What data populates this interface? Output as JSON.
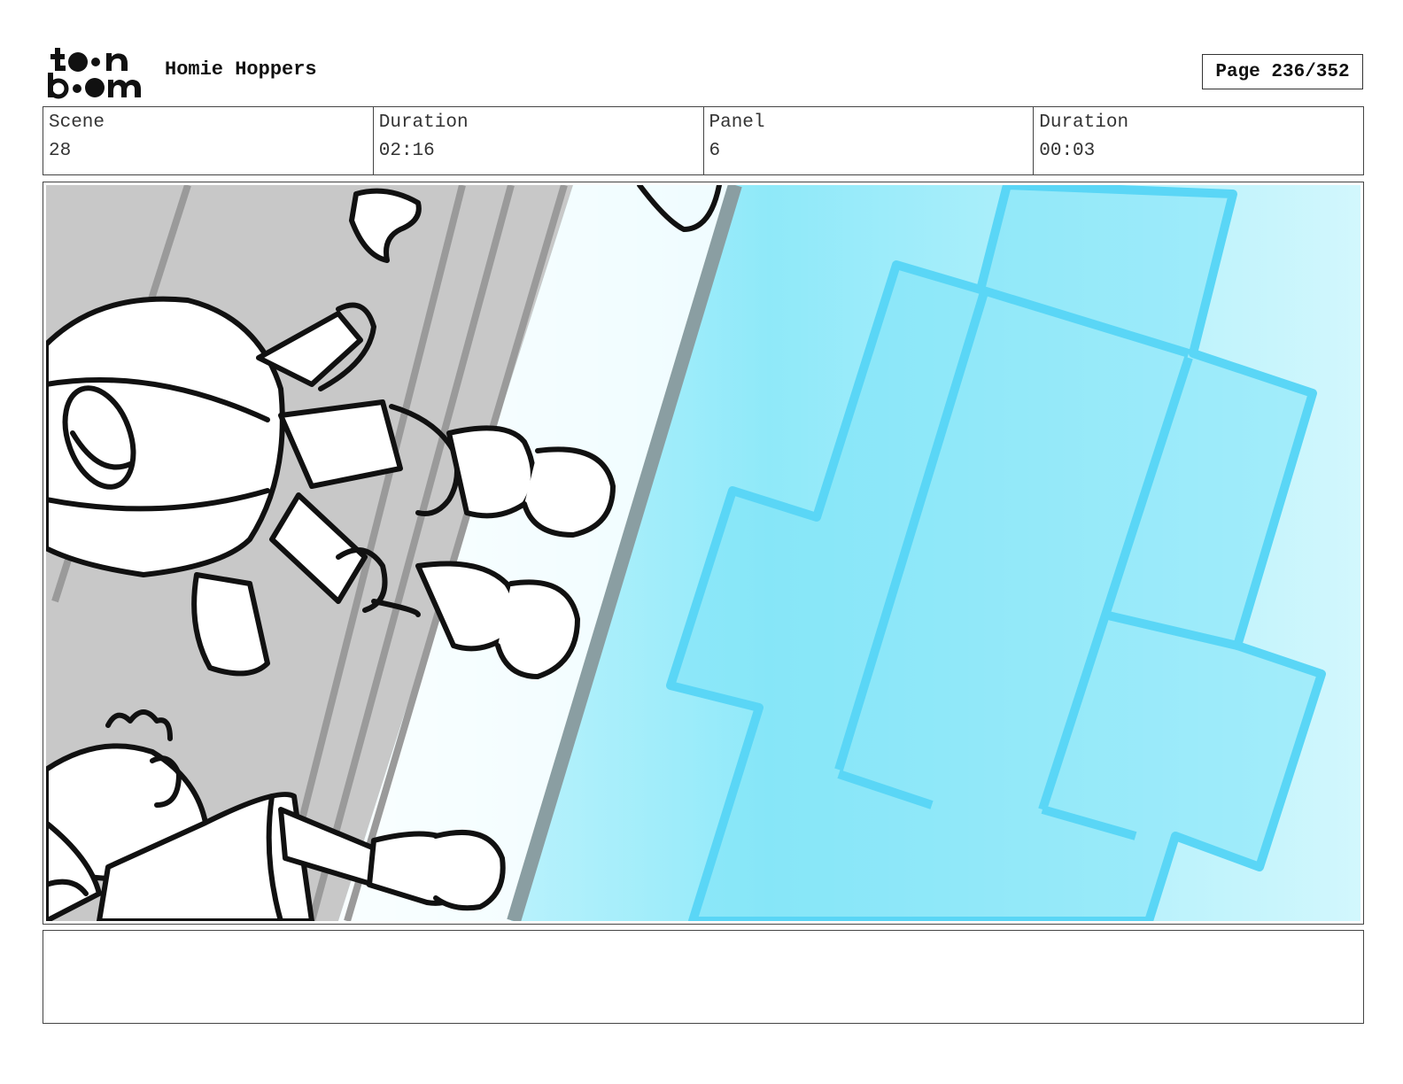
{
  "header": {
    "logo_text": "toonboom",
    "project_title": "Homie Hoppers",
    "page_label": "Page 236/352"
  },
  "info": {
    "scene_label": "Scene",
    "scene_value": "28",
    "scene_duration_label": "Duration",
    "scene_duration_value": "02:16",
    "panel_label": "Panel",
    "panel_value": "6",
    "panel_duration_label": "Duration",
    "panel_duration_value": "00:03"
  },
  "notes": {
    "text": ""
  },
  "colors": {
    "water_light": "#e6fbff",
    "water_mid": "#8ee9f8",
    "tile_outline": "#5ad4f5",
    "sidewalk": "#c9c9c9",
    "ink": "#111111"
  }
}
